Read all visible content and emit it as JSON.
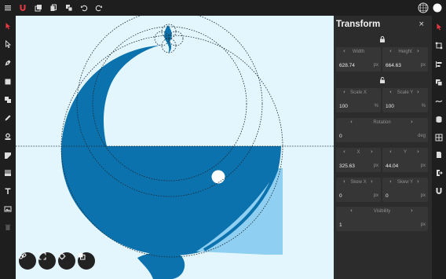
{
  "colors": {
    "accent": "#e53945",
    "whale": "#0b72ae",
    "whale_light": "#8fd0f2",
    "canvas_bg": "#e3f6fd",
    "panel_bg": "#2c2c2c",
    "toolbar_bg": "#1e1e1e"
  },
  "topbar": {
    "icons": [
      "menu-icon",
      "magnet-icon",
      "layers-icon",
      "copy-icon",
      "duplicate-icon",
      "undo-icon",
      "redo-icon",
      "grid-icon",
      "circle-icon"
    ]
  },
  "left_tools": [
    "pointer-tool-icon",
    "select-tool-icon",
    "pen-tool-icon",
    "rectangle-tool-icon",
    "boolean-tool-icon",
    "pencil-tool-icon",
    "stamp-tool-icon",
    "crop-tool-icon",
    "gradient-tool-icon",
    "text-tool-icon",
    "image-tool-icon",
    "trash-icon"
  ],
  "canvas_buttons": [
    "link-icon",
    "fit-screen-icon",
    "target-icon",
    "arrange-icon"
  ],
  "transform": {
    "title": "Transform",
    "close": "×",
    "width": {
      "label": "Width",
      "value": "628.74",
      "unit": "px"
    },
    "height": {
      "label": "Height",
      "value": "664.63",
      "unit": "px"
    },
    "scale_x": {
      "label": "Scale X",
      "value": "100",
      "unit": "%"
    },
    "scale_y": {
      "label": "Scale Y",
      "value": "100",
      "unit": "%"
    },
    "rotation": {
      "label": "Rotation",
      "value": "0",
      "unit": "deg"
    },
    "x": {
      "label": "X",
      "value": "325.63",
      "unit": "px"
    },
    "y": {
      "label": "Y",
      "value": "44.04",
      "unit": "px"
    },
    "skew_x": {
      "label": "Skew X",
      "value": "0",
      "unit": "px"
    },
    "skew_y": {
      "label": "Skew Y",
      "value": "0",
      "unit": "px"
    },
    "visibility": {
      "label": "Visibility",
      "value": "1",
      "unit": "px"
    }
  },
  "right_tools": [
    "pointer-mode-icon",
    "transform-icon",
    "align-icon",
    "shapes-icon",
    "path-icon",
    "layers-stack-icon",
    "grid-table-icon",
    "page-icon",
    "export-icon",
    "magnet-tool-icon"
  ]
}
